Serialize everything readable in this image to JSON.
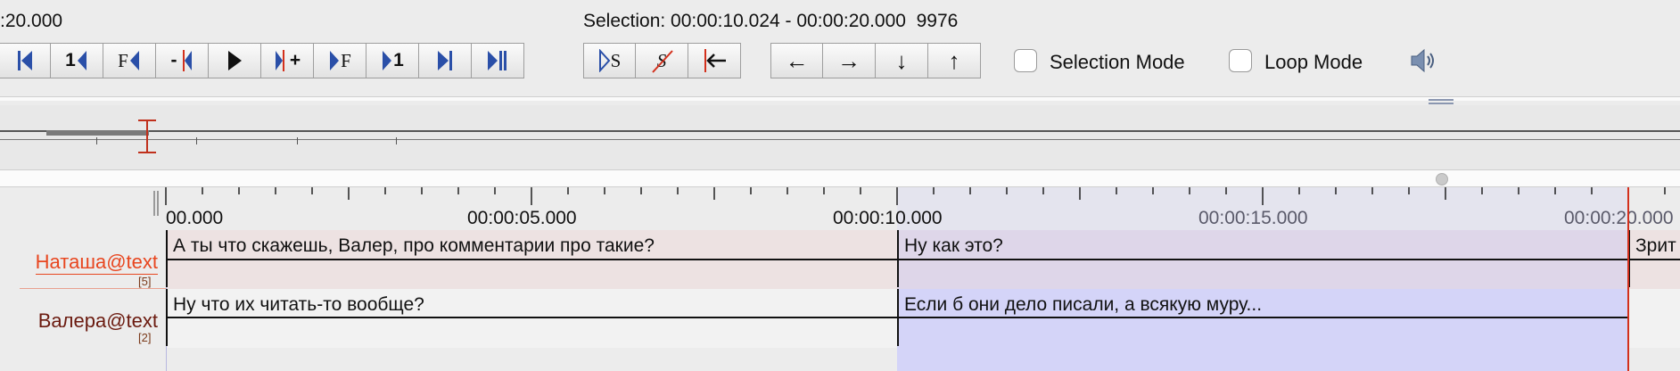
{
  "toolbar": {
    "time_fragment": ":20.000",
    "selection_label": "Selection: 00:00:10.024 - 00:00:20.000  9976",
    "play_buttons": [
      {
        "name": "go-to-begin-button",
        "icon": "skip-to-begin-icon",
        "label": ""
      },
      {
        "name": "previous-frame-button",
        "icon": "previous-frame-icon",
        "label": "1"
      },
      {
        "name": "previous-f-button",
        "icon": "previous-f-icon",
        "label": "F"
      },
      {
        "name": "previous-pixel-button",
        "icon": "previous-pixel-icon",
        "label": "-"
      },
      {
        "name": "play-button",
        "icon": "play-icon",
        "label": ""
      },
      {
        "name": "next-pixel-button",
        "icon": "next-pixel-icon",
        "label": "+"
      },
      {
        "name": "next-f-button",
        "icon": "next-f-icon",
        "label": "F"
      },
      {
        "name": "next-frame-button",
        "icon": "next-frame-icon",
        "label": "1"
      },
      {
        "name": "next-page-button",
        "icon": "next-page-icon",
        "label": ""
      },
      {
        "name": "go-to-end-button",
        "icon": "skip-to-end-icon",
        "label": ""
      }
    ],
    "selection_buttons": [
      {
        "name": "play-selection-button",
        "icon": "play-selection-icon",
        "label": "S"
      },
      {
        "name": "clear-selection-button",
        "icon": "clear-selection-icon",
        "label": "S"
      },
      {
        "name": "selection-begin-button",
        "icon": "selection-begin-icon",
        "label": ""
      }
    ],
    "arrow_buttons": [
      {
        "name": "left-arrow-button",
        "icon": "arrow-left-icon",
        "label": "←"
      },
      {
        "name": "right-arrow-button",
        "icon": "arrow-right-icon",
        "label": "→"
      },
      {
        "name": "down-arrow-button",
        "icon": "arrow-down-icon",
        "label": "↓"
      },
      {
        "name": "up-arrow-button",
        "icon": "arrow-up-icon",
        "label": "↑"
      }
    ],
    "selection_mode_label": "Selection Mode",
    "selection_mode_checked": false,
    "loop_mode_label": "Loop Mode",
    "loop_mode_checked": false,
    "volume_icon": "speaker-icon"
  },
  "ruler": {
    "labels": [
      "00.000",
      "00:00:05.000",
      "00:00:10.000",
      "00:00:15.000",
      "00:00:20.000"
    ]
  },
  "tiers": [
    {
      "name": "Наташа@text",
      "count": "[5]",
      "color": "#e8461f",
      "annotations": [
        "А ты что скажешь, Валер, про комментарии про такие?",
        "Ну как это?",
        "Зрит"
      ]
    },
    {
      "name": "Валера@text",
      "count": "[2]",
      "color": "#6b1a0f",
      "annotations": [
        "Ну что их читать-то вообще?",
        "Если б они дело писали, а всякую муру..."
      ]
    }
  ],
  "colors": {
    "selection": "#d4d4f8",
    "crosshair": "#d3301c",
    "tier_active_bg": "#ede2e2",
    "tier_bg": "#f2f2f2"
  }
}
